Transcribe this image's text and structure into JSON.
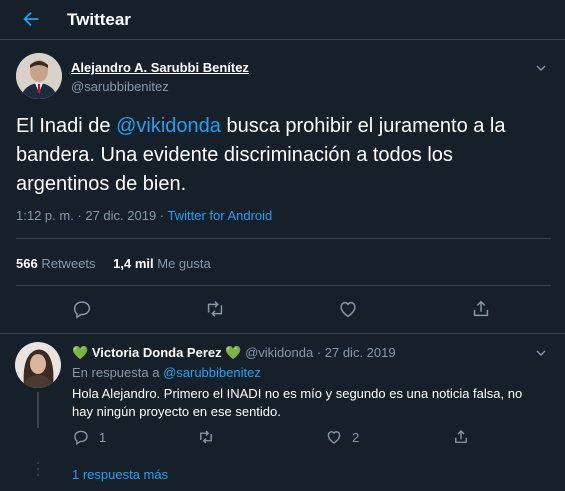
{
  "header": {
    "title": "Twittear"
  },
  "tweet": {
    "author_name": "Alejandro A. Sarubbi Benítez",
    "author_handle": "@sarubbibenitez",
    "text_before": "El Inadi de ",
    "mention": "@vikidonda",
    "text_after": " busca prohibir el juramento a la bandera. Una evidente discriminación a todos los argentinos de bien.",
    "time_date": "1:12 p. m. · 27 dic. 2019 · ",
    "source": "Twitter for Android",
    "retweets_count": "566",
    "retweets_label": "Retweets",
    "likes_count": "1,4 mil",
    "likes_label": "Me gusta"
  },
  "reply": {
    "heart_left": "💚",
    "author_name": "Victoria Donda Perez",
    "heart_right": "💚",
    "author_handle": "@vikidonda",
    "date": "· 27 dic. 2019",
    "in_reply_prefix": "En respuesta a ",
    "in_reply_handle": "@sarubbibenitez",
    "text": "Hola Alejandro. Primero el INADI no es mío y segundo es una noticia falsa, no hay ningún proyecto en ese sentido.",
    "replies_count": "1",
    "likes_count": "2"
  },
  "more_replies": "1 respuesta más",
  "colors": {
    "background": "#15202b",
    "accent": "#1da1f2",
    "muted": "#8899a6",
    "border": "#38444d"
  },
  "icons": [
    "back-arrow-icon",
    "chevron-down-icon",
    "reply-icon",
    "retweet-icon",
    "like-icon",
    "share-icon"
  ]
}
